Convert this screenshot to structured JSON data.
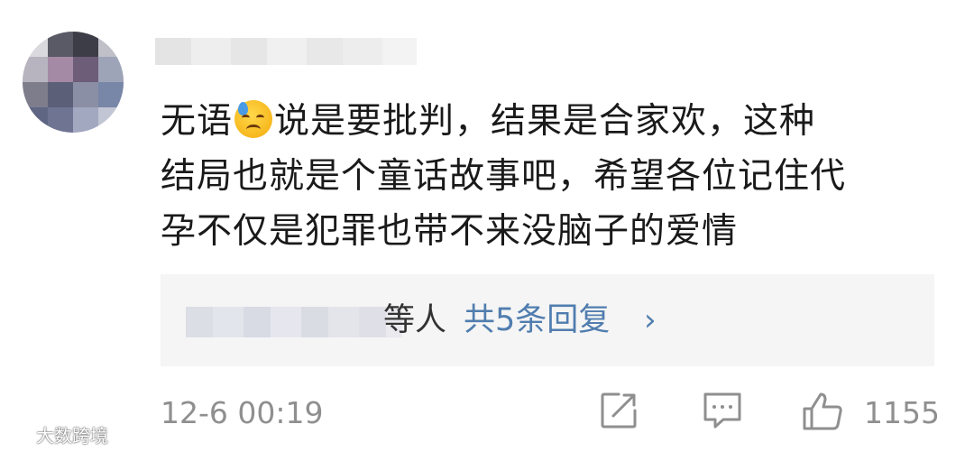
{
  "comment": {
    "lines": [
      {
        "before_emoji": "无语",
        "after_emoji": "说是要批判，结果是合家欢，这种"
      },
      {
        "text": "结局也就是个童话故事吧，希望各位记住代"
      },
      {
        "text": "孕不仅是犯罪也带不来没脑子的爱情"
      }
    ],
    "emoji_icon": "sweat-sad-face-icon"
  },
  "replies": {
    "suffix": "等人",
    "link_label": "共5条回复",
    "chevron": "›"
  },
  "footer": {
    "timestamp": "12-6 00:19",
    "share_icon": "share-icon",
    "comment_icon": "comment-icon",
    "like_icon": "thumbs-up-icon",
    "like_count": "1155"
  },
  "watermark": {
    "text": "大数跨境"
  },
  "colors": {
    "text": "#1a1a1a",
    "link": "#507daf",
    "muted": "#8f8f8f",
    "reply_bg": "#f5f5f5"
  }
}
